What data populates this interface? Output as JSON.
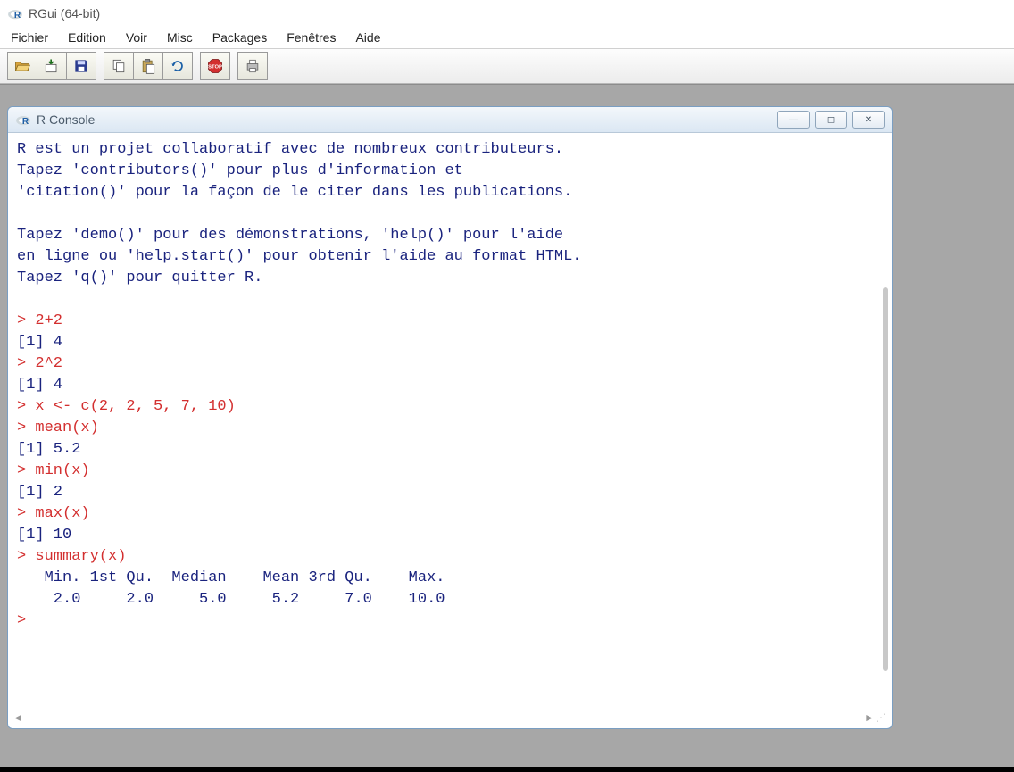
{
  "window": {
    "title": "RGui (64-bit)"
  },
  "menu": {
    "items": [
      "Fichier",
      "Edition",
      "Voir",
      "Misc",
      "Packages",
      "Fenêtres",
      "Aide"
    ]
  },
  "child": {
    "title": "R Console"
  },
  "console": {
    "intro1": "R est un projet collaboratif avec de nombreux contributeurs.",
    "intro2": "Tapez 'contributors()' pour plus d'information et",
    "intro3": "'citation()' pour la façon de le citer dans les publications.",
    "intro4": "Tapez 'demo()' pour des démonstrations, 'help()' pour l'aide",
    "intro5": "en ligne ou 'help.start()' pour obtenir l'aide au format HTML.",
    "intro6": "Tapez 'q()' pour quitter R.",
    "cmd1": "> 2+2",
    "out1": "[1] 4",
    "cmd2": "> 2^2",
    "out2": "[1] 4",
    "cmd3": "> x <- c(2, 2, 5, 7, 10)",
    "cmd4": "> mean(x)",
    "out4": "[1] 5.2",
    "cmd5": "> min(x)",
    "out5": "[1] 2",
    "cmd6": "> max(x)",
    "out6": "[1] 10",
    "cmd7": "> summary(x)",
    "sumhdr": "   Min. 1st Qu.  Median    Mean 3rd Qu.    Max. ",
    "sumval": "    2.0     2.0     5.0     5.2     7.0    10.0 ",
    "prompt": "> "
  },
  "winbtns": {
    "min": "—",
    "max": "◻",
    "close": "✕"
  },
  "scroll": {
    "left": "◄",
    "right": "►",
    "grip": "⋰"
  }
}
